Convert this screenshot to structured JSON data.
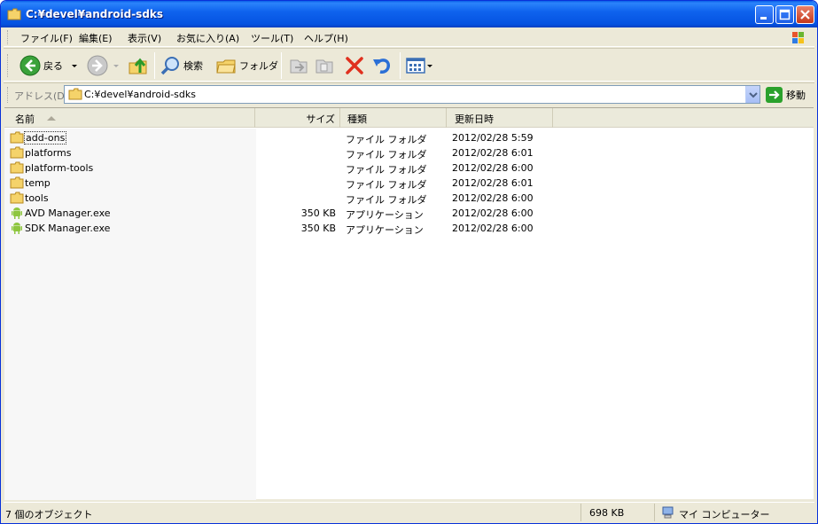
{
  "window": {
    "title": "C:¥devel¥android-sdks"
  },
  "menu": {
    "items": [
      "ファイル(F)",
      "編集(E)",
      "表示(V)",
      "お気に入り(A)",
      "ツール(T)",
      "ヘルプ(H)"
    ]
  },
  "toolbar": {
    "back_label": "戻る",
    "search_label": "検索",
    "folders_label": "フォルダ"
  },
  "address": {
    "label": "アドレス(D)",
    "value": "C:¥devel¥android-sdks",
    "go_label": "移動"
  },
  "columns": {
    "name": "名前",
    "size": "サイズ",
    "type": "種類",
    "modified": "更新日時"
  },
  "files": [
    {
      "name": "add-ons",
      "size": "",
      "type": "ファイル フォルダ",
      "modified": "2012/02/28 5:59",
      "icon": "folder-icon"
    },
    {
      "name": "platforms",
      "size": "",
      "type": "ファイル フォルダ",
      "modified": "2012/02/28 6:01",
      "icon": "folder-icon"
    },
    {
      "name": "platform-tools",
      "size": "",
      "type": "ファイル フォルダ",
      "modified": "2012/02/28 6:00",
      "icon": "folder-icon"
    },
    {
      "name": "temp",
      "size": "",
      "type": "ファイル フォルダ",
      "modified": "2012/02/28 6:01",
      "icon": "folder-icon"
    },
    {
      "name": "tools",
      "size": "",
      "type": "ファイル フォルダ",
      "modified": "2012/02/28 6:00",
      "icon": "folder-icon"
    },
    {
      "name": "AVD Manager.exe",
      "size": "350 KB",
      "type": "アプリケーション",
      "modified": "2012/02/28 6:00",
      "icon": "android-icon"
    },
    {
      "name": "SDK Manager.exe",
      "size": "350 KB",
      "type": "アプリケーション",
      "modified": "2012/02/28 6:00",
      "icon": "android-icon"
    }
  ],
  "status": {
    "objects": "7 個のオブジェクト",
    "size": "698 KB",
    "location": "マイ コンピューター"
  },
  "colors": {
    "title_blue": "#0552e0",
    "window_bg": "#ece9d8",
    "folder_yellow": "#f5d36a",
    "android_green": "#8ec63f",
    "delete_red": "#e0301e",
    "undo_blue": "#2a6fd6"
  }
}
